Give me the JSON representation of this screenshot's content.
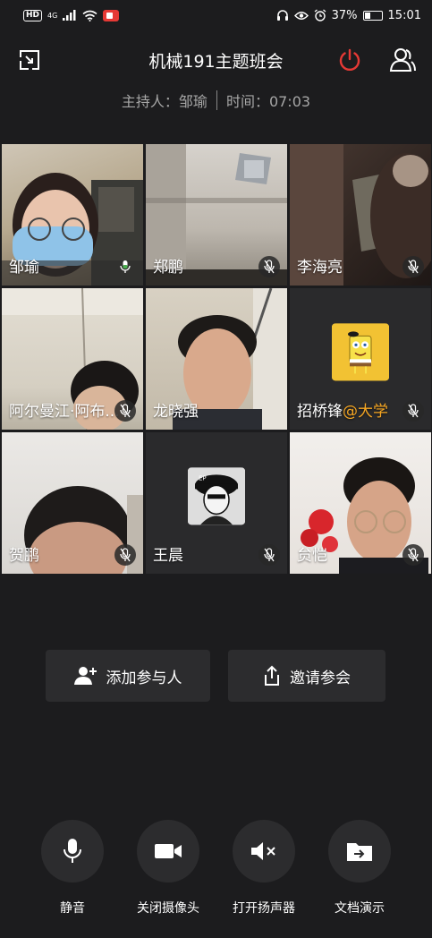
{
  "status_bar": {
    "hd": "HD",
    "net": "4G",
    "battery": "37%",
    "battery_level": 0.37,
    "time": "15:01"
  },
  "header": {
    "title": "机械191主题班会",
    "host_label": "主持人：邹瑜",
    "time_label": "时间：07:03",
    "colors": {
      "power": "#e53935"
    }
  },
  "participants": [
    {
      "name": "邹瑜",
      "mic": "on"
    },
    {
      "name": "郑鹏",
      "mic": "muted"
    },
    {
      "name": "李海亮",
      "mic": "muted"
    },
    {
      "name": "阿尔曼江·阿布...",
      "mic": "muted"
    },
    {
      "name": "龙晓强",
      "mic": "none"
    },
    {
      "name": "招桥锋",
      "tag": "@大学",
      "mic": "muted"
    },
    {
      "name": "贺鹏",
      "mic": "muted"
    },
    {
      "name": "王晨",
      "mic": "muted"
    },
    {
      "name": "贠恺",
      "mic": "muted"
    }
  ],
  "actions": {
    "add_participant": "添加参与人",
    "invite": "邀请参会"
  },
  "controls": {
    "mute": "静音",
    "camera_off": "关闭摄像头",
    "speaker_on": "打开扬声器",
    "doc_share": "文档演示"
  }
}
